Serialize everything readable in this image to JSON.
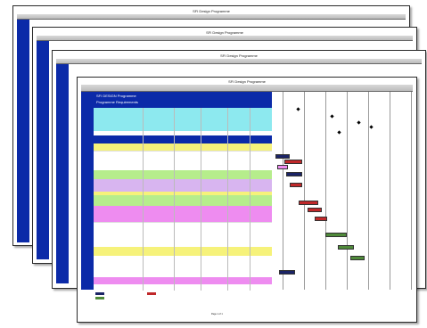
{
  "sheet_title": "SFI Design Programme",
  "front_sheet": {
    "section_title": "SFI DESIGN Programme",
    "subsection": "Programme Requirements",
    "footer_note": "Page 1 of 1"
  },
  "colors": {
    "header_blue": "#0b2aa8",
    "row_yellow": "#f6f27a",
    "row_cyan": "#8de9ef",
    "row_green": "#b6ed8c",
    "row_magenta": "#ee8cf0",
    "row_lilac": "#d8b5f0",
    "bar_red": "#c0282a",
    "bar_green": "#4f8a3a",
    "bar_navy": "#1b2466"
  }
}
